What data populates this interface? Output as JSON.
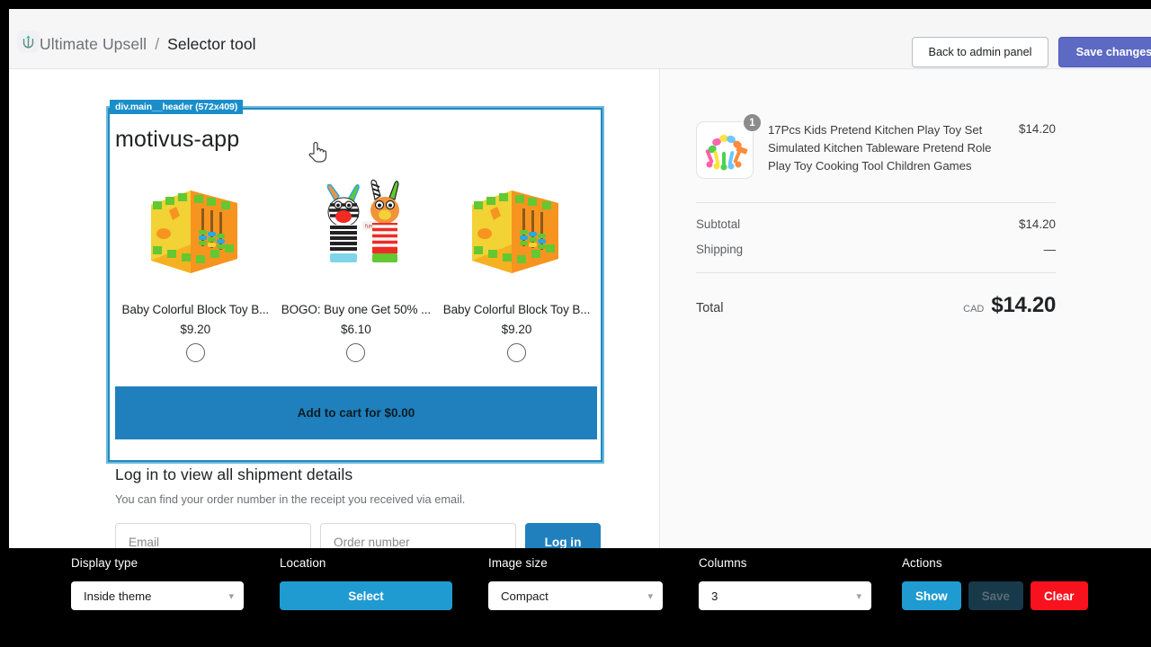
{
  "topbar": {
    "logo_icon": "anchor-logo-icon",
    "brand": "Ultimate Upsell",
    "separator": "/",
    "page": "Selector tool",
    "back_button": "Back to admin panel",
    "save_button": "Save changes"
  },
  "inspector": {
    "badge": "div.main__header (572x409)",
    "outline_color": "#1f8ac0",
    "badge_color": "#1a8ec9"
  },
  "widget": {
    "title": "motivus-app",
    "cta": "Add to cart for $0.00",
    "cta_color": "#1f80bd",
    "products": [
      {
        "title": "Baby Colorful Block Toy B...",
        "price": "$9.20",
        "image": "block-toy-cube-image",
        "selected": false
      },
      {
        "title": "BOGO: Buy one Get 50% ...",
        "price": "$6.10",
        "image": "zebra-giraffe-sock-rattle-image",
        "selected": false
      },
      {
        "title": "Baby Colorful Block Toy B...",
        "price": "$9.20",
        "image": "block-toy-cube-image",
        "selected": false
      }
    ]
  },
  "login": {
    "heading": "Log in to view all shipment details",
    "subtext": "You can find your order number in the receipt you received via email.",
    "email_placeholder": "Email",
    "email_value": "",
    "order_placeholder": "Order number",
    "order_value": "",
    "button": "Log in"
  },
  "summary": {
    "item": {
      "quantity": "1",
      "name": "17Pcs Kids Pretend Kitchen Play Toy Set Simulated Kitchen Tableware Pretend Role Play Toy Cooking Tool Children Games",
      "price": "$14.20",
      "image": "kitchen-play-set-image"
    },
    "subtotal_label": "Subtotal",
    "subtotal_value": "$14.20",
    "shipping_label": "Shipping",
    "shipping_value": "—",
    "total_label": "Total",
    "total_currency": "CAD",
    "total_value": "$14.20"
  },
  "toolbar": {
    "display_type": {
      "label": "Display type",
      "value": "Inside theme"
    },
    "location": {
      "label": "Location",
      "button": "Select"
    },
    "image_size": {
      "label": "Image size",
      "value": "Compact"
    },
    "columns": {
      "label": "Columns",
      "value": "3"
    },
    "actions": {
      "label": "Actions",
      "show": "Show",
      "save": "Save",
      "clear": "Clear",
      "show_color": "#1f9bd1",
      "save_color": "#17394a",
      "clear_color": "#f8121d"
    }
  },
  "cursor": {
    "type": "pointing-hand-cursor"
  }
}
